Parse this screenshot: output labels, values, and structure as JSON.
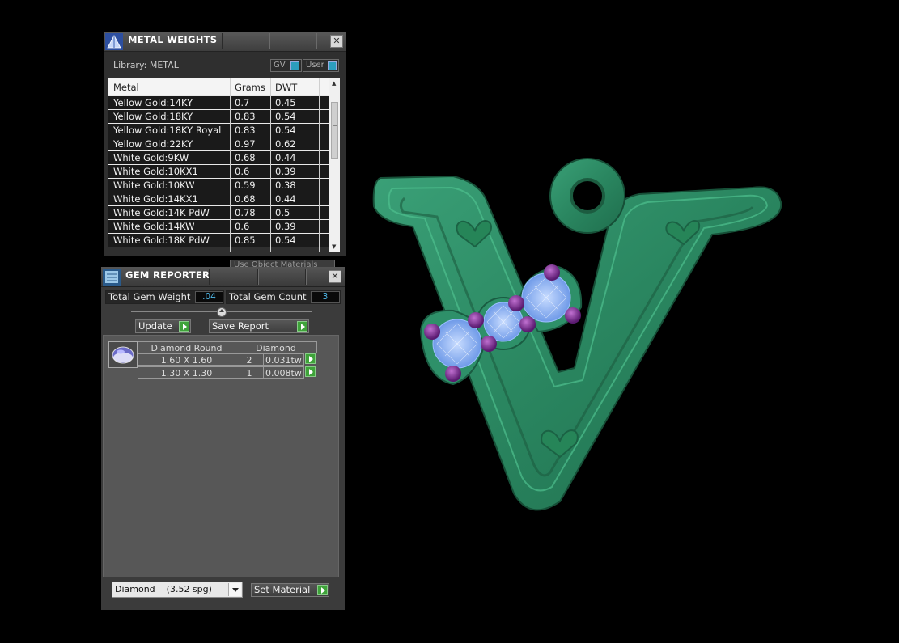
{
  "metal_panel": {
    "title": "METAL WEIGHTS",
    "library_label": "Library: METAL",
    "toggle_gv": "GV",
    "toggle_user": "User",
    "columns": [
      "Metal",
      "Grams",
      "DWT"
    ],
    "rows": [
      {
        "metal": "Yellow Gold:14KY",
        "grams": "0.7",
        "dwt": "0.45"
      },
      {
        "metal": "Yellow Gold:18KY",
        "grams": "0.83",
        "dwt": "0.54"
      },
      {
        "metal": "Yellow Gold:18KY Royal",
        "grams": "0.83",
        "dwt": "0.54"
      },
      {
        "metal": "Yellow Gold:22KY",
        "grams": "0.97",
        "dwt": "0.62"
      },
      {
        "metal": "White Gold:9KW",
        "grams": "0.68",
        "dwt": "0.44"
      },
      {
        "metal": "White Gold:10KX1",
        "grams": "0.6",
        "dwt": "0.39"
      },
      {
        "metal": "White Gold:10KW",
        "grams": "0.59",
        "dwt": "0.38"
      },
      {
        "metal": "White Gold:14KX1",
        "grams": "0.68",
        "dwt": "0.44"
      },
      {
        "metal": "White Gold:14K PdW",
        "grams": "0.78",
        "dwt": "0.5"
      },
      {
        "metal": "White Gold:14KW",
        "grams": "0.6",
        "dwt": "0.39"
      },
      {
        "metal": "White Gold:18K PdW",
        "grams": "0.85",
        "dwt": "0.54"
      }
    ],
    "partial_option": "Use Object Materials"
  },
  "gem_panel": {
    "title": "GEM REPORTER",
    "total_weight_label": "Total Gem Weight",
    "total_weight_value": ".04",
    "total_count_label": "Total Gem Count",
    "total_count_value": "3",
    "update_label": "Update",
    "save_report_label": "Save Report",
    "table": {
      "shape_header": "Diamond Round",
      "material_header": "Diamond",
      "rows": [
        {
          "size": "1.60 X 1.60",
          "count": "2",
          "weight": "0.031tw"
        },
        {
          "size": "1.30 X 1.30",
          "count": "1",
          "weight": "0.008tw"
        }
      ]
    },
    "material_select": "Diamond    (3.52 spg)",
    "set_material_label": "Set Material"
  },
  "colors": {
    "model_green": "#2e8a62",
    "gem_blue": "#8fb4f0",
    "prong_purple": "#7a2a8a",
    "accent_play": "#3fa33a",
    "value_blue": "#4fb8e8"
  }
}
